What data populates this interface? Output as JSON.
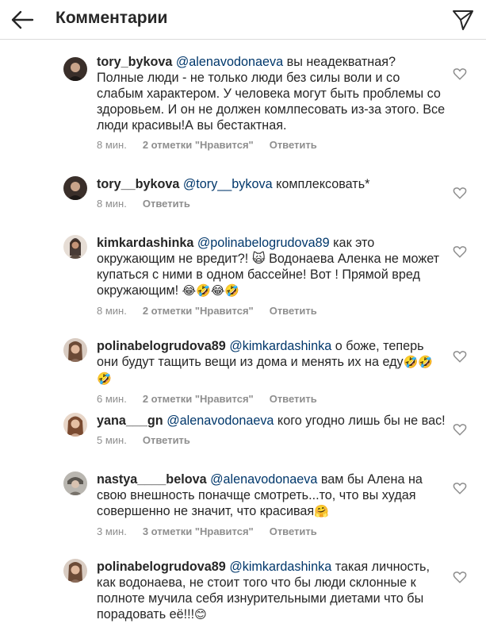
{
  "header": {
    "title": "Комментарии"
  },
  "comments": [
    {
      "username": "tory_bykova",
      "mention": "@alenavodonaeva",
      "text": " вы неадекватная? Полные люди - не только люди без силы воли и со слабым характером. У человека могут быть проблемы со здоровьем. И он не должен комлпесовать из-за этого.  Все люди красивы!А вы бестактная.",
      "emoji": "",
      "time": "8 мин.",
      "likes": "2 отметки \"Нравится\"",
      "reply": "Ответить"
    },
    {
      "username": "tory__bykova",
      "mention": "@tory__bykova",
      "text": " комплексовать*",
      "emoji": "",
      "time": "8 мин.",
      "likes": "",
      "reply": "Ответить"
    },
    {
      "username": "kimkardashinka",
      "mention": "@polinabelogrudova89",
      "text": " как это окружающим не вредит?! 🙀 Водонаева Аленка не может купаться с ними в одном бассейне! Вот ! Прямой вред окружающим! ",
      "emoji": "😂🤣😂🤣",
      "time": "8 мин.",
      "likes": "2 отметки \"Нравится\"",
      "reply": "Ответить"
    },
    {
      "username": "polinabelogrudova89",
      "mention": "@kimkardashinka",
      "text": " о боже, теперь они будут тащить вещи из дома и менять их на еду",
      "emoji": "🤣🤣🤣",
      "time": "6 мин.",
      "likes": "2 отметки \"Нравится\"",
      "reply": "Ответить"
    },
    {
      "username": "yana___gn",
      "mention": "@alenavodonaeva",
      "text": " кого угодно лишь бы не вас!",
      "emoji": "",
      "time": "5 мин.",
      "likes": "",
      "reply": "Ответить"
    },
    {
      "username": "nastya____belova",
      "mention": "@alenavodonaeva",
      "text": " вам бы Алена на свою внешность  поначще смотреть...то, что вы худая совершенно не значит, что  красивая",
      "emoji": "🤗",
      "time": "3 мин.",
      "likes": "3 отметки \"Нравится\"",
      "reply": "Ответить"
    },
    {
      "username": "polinabelogrudova89",
      "mention": "@kimkardashinka",
      "text": " такая личность, как водонаева, не стоит того что бы люди склонные к полноте мучила себя изнурительными диетами что бы порадовать  её!!!",
      "emoji": "😊",
      "time": "",
      "likes": "",
      "reply": ""
    }
  ],
  "colors": {
    "text": "#262626",
    "mention": "#00376b",
    "meta": "#8e8e8e",
    "divider": "#dbdbdb"
  },
  "icons": {
    "back": "arrow-left-icon",
    "send": "paper-plane-icon",
    "like": "heart-outline-icon"
  }
}
